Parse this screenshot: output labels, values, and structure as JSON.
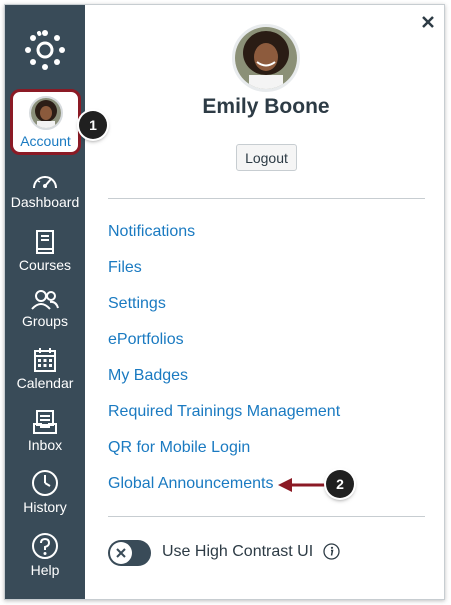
{
  "sidebar": {
    "account_label": "Account",
    "items": [
      {
        "label": "Dashboard",
        "icon": "dashboard-icon"
      },
      {
        "label": "Courses",
        "icon": "book-icon"
      },
      {
        "label": "Groups",
        "icon": "people-icon"
      },
      {
        "label": "Calendar",
        "icon": "calendar-icon"
      },
      {
        "label": "Inbox",
        "icon": "inbox-icon"
      },
      {
        "label": "History",
        "icon": "clock-icon"
      },
      {
        "label": "Help",
        "icon": "question-icon"
      }
    ]
  },
  "tray": {
    "user_name": "Emily Boone",
    "logout_label": "Logout",
    "links": [
      "Notifications",
      "Files",
      "Settings",
      "ePortfolios",
      "My Badges",
      "Required Trainings Management",
      "QR for Mobile Login",
      "Global Announcements"
    ],
    "high_contrast_label": "Use High Contrast UI"
  },
  "callouts": {
    "one": "1",
    "two": "2"
  },
  "colors": {
    "sidebar_bg": "#394b58",
    "link": "#1a7ac1",
    "highlight_border": "#8b1a25",
    "arrow": "#8b1a25",
    "text": "#2d3b45"
  }
}
